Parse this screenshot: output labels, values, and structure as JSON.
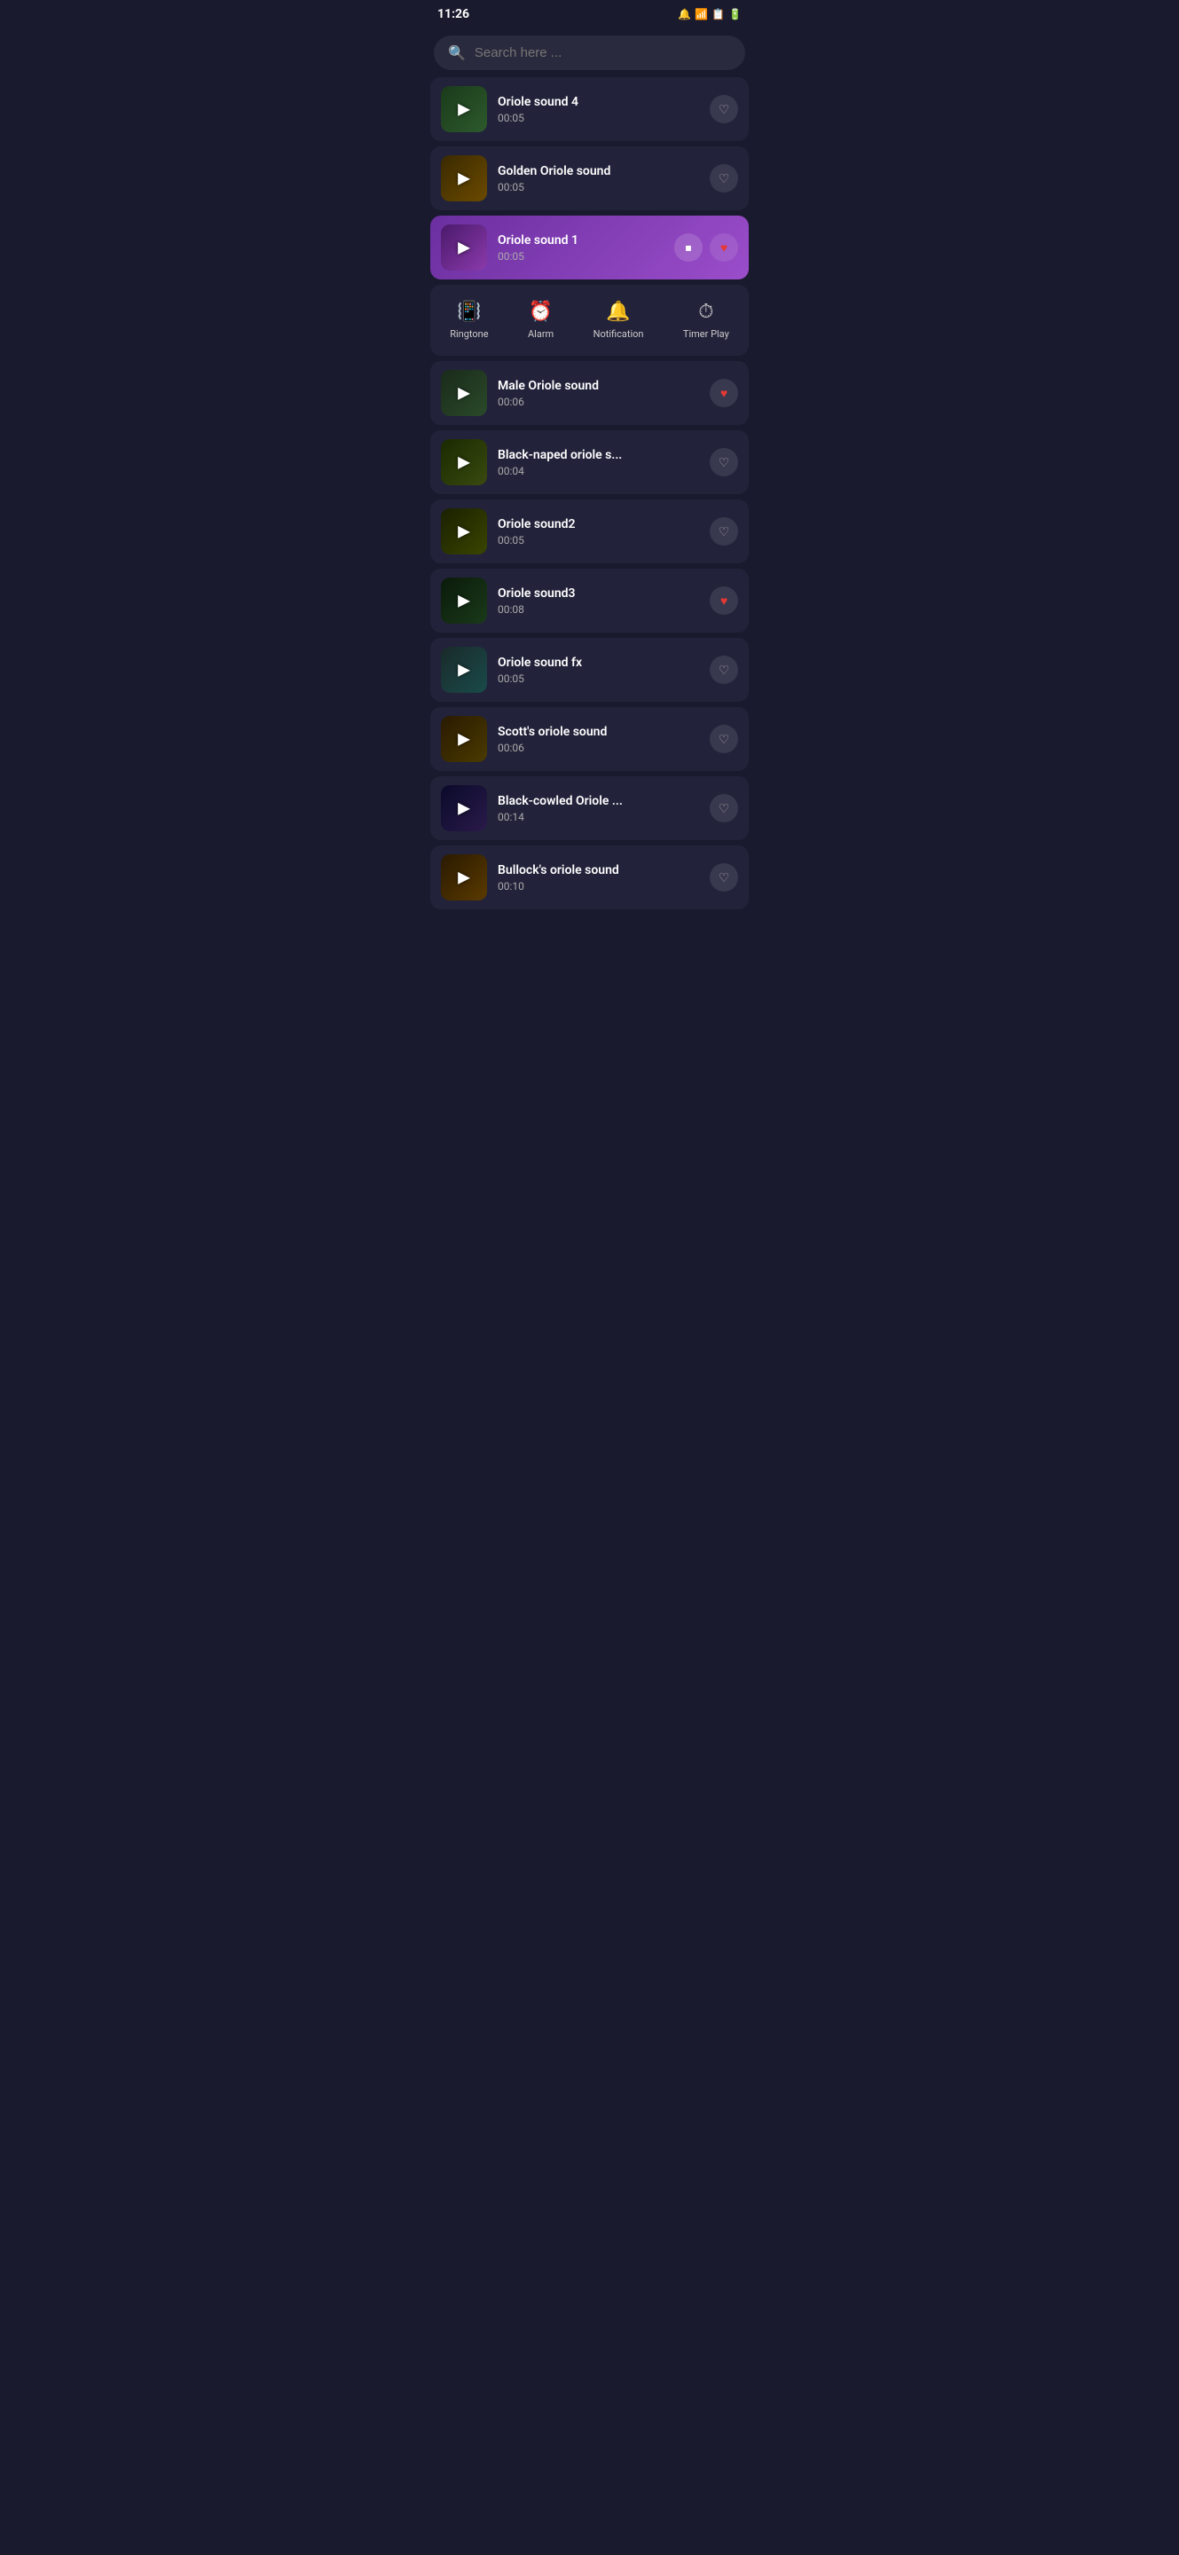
{
  "statusBar": {
    "time": "11:26",
    "icons": [
      "notification",
      "sim",
      "tablet",
      "battery"
    ]
  },
  "search": {
    "placeholder": "Search here ..."
  },
  "songs": [
    {
      "id": "oriole-sound-4",
      "title": "Oriole sound 4",
      "duration": "00:05",
      "favorited": false,
      "active": false,
      "thumbClass": "thumb-oriole4"
    },
    {
      "id": "golden-oriole-sound",
      "title": "Golden Oriole sound",
      "duration": "00:05",
      "favorited": false,
      "active": false,
      "thumbClass": "thumb-golden"
    },
    {
      "id": "oriole-sound-1",
      "title": "Oriole sound 1",
      "duration": "00:05",
      "favorited": true,
      "active": true,
      "thumbClass": "thumb-oriole1",
      "showOptions": true
    },
    {
      "id": "male-oriole-sound",
      "title": "Male Oriole sound",
      "duration": "00:06",
      "favorited": true,
      "active": false,
      "thumbClass": "thumb-male"
    },
    {
      "id": "black-naped-oriole",
      "title": "Black-naped oriole s...",
      "duration": "00:04",
      "favorited": false,
      "active": false,
      "thumbClass": "thumb-blacknaped"
    },
    {
      "id": "oriole-sound2",
      "title": "Oriole sound2",
      "duration": "00:05",
      "favorited": false,
      "active": false,
      "thumbClass": "thumb-oriole2"
    },
    {
      "id": "oriole-sound3",
      "title": "Oriole sound3",
      "duration": "00:08",
      "favorited": true,
      "active": false,
      "thumbClass": "thumb-oriole3"
    },
    {
      "id": "oriole-sound-fx",
      "title": "Oriole sound fx",
      "duration": "00:05",
      "favorited": false,
      "active": false,
      "thumbClass": "thumb-oriolefx"
    },
    {
      "id": "scotts-oriole-sound",
      "title": "Scott's oriole sound",
      "duration": "00:06",
      "favorited": false,
      "active": false,
      "thumbClass": "thumb-scotts"
    },
    {
      "id": "black-cowled-oriole",
      "title": "Black-cowled Oriole ...",
      "duration": "00:14",
      "favorited": false,
      "active": false,
      "thumbClass": "thumb-blackcowled"
    },
    {
      "id": "bullocks-oriole-sound",
      "title": "Bullock's oriole sound",
      "duration": "00:10",
      "favorited": false,
      "active": false,
      "thumbClass": "thumb-bullocks"
    }
  ],
  "options": {
    "ringtone": {
      "label": "Ringtone",
      "icon": "📳"
    },
    "alarm": {
      "label": "Alarm",
      "icon": "⏰"
    },
    "notification": {
      "label": "Notification",
      "icon": "🔔"
    },
    "timerPlay": {
      "label": "Timer Play",
      "icon": "⏱"
    }
  }
}
